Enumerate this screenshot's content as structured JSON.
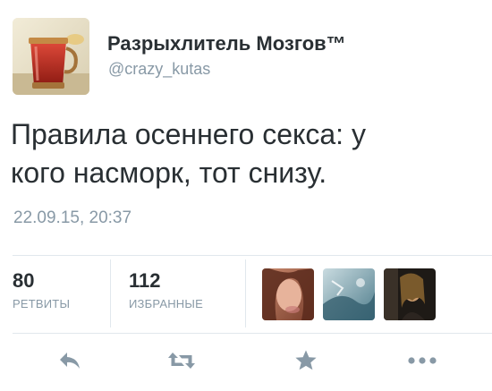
{
  "tweet": {
    "author_name": "Разрыхлитель Мозгов™",
    "author_handle": "@crazy_kutas",
    "text_line1": "Правила осеннего секса: у",
    "text_line2": "кого насморк, тот снизу.",
    "timestamp": "22.09.15, 20:37"
  },
  "stats": {
    "retweets_count": "80",
    "retweets_label": "РЕТВИТЫ",
    "favorites_count": "112",
    "favorites_label": "ИЗБРАННЫЕ"
  },
  "icons": {
    "avatar": "glass-of-tea-avatar",
    "favoriters": [
      "woman-portrait-avatar",
      "abstract-blue-avatar",
      "dark-portrait-avatar"
    ],
    "actions": [
      "reply-icon",
      "retweet-icon",
      "favorite-star-icon",
      "more-dots-icon"
    ]
  },
  "colors": {
    "text": "#292f33",
    "secondary": "#8899a6",
    "divider": "#e1e8ed",
    "action_icon": "#8899a6"
  }
}
